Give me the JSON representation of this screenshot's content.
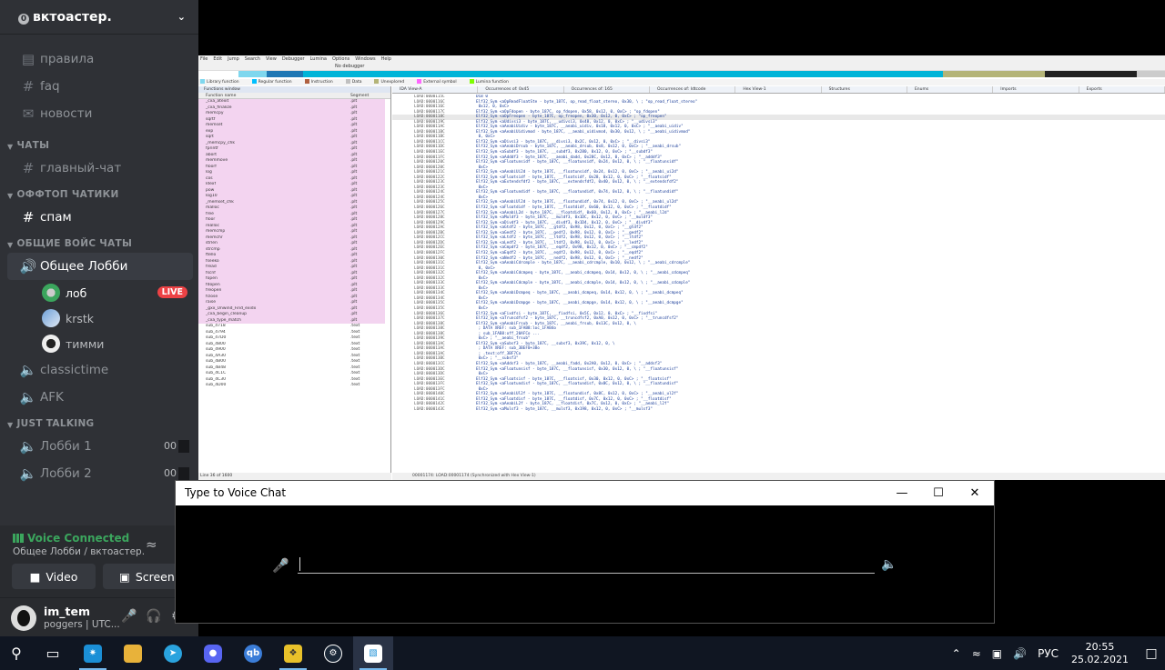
{
  "server": {
    "name": "вктоастер.",
    "badge": "0"
  },
  "channels_top": [
    {
      "icon": "📋",
      "label": "правила"
    },
    {
      "icon": "#",
      "label": "faq"
    },
    {
      "icon": "📢",
      "label": "новости"
    }
  ],
  "cat_chats": "ЧАТЫ",
  "chan_main": "главный-чат",
  "cat_offtop": "ОФФТОП ЧАТИКИ",
  "chan_spam": "спам",
  "cat_voice": "ОБЩИЕ ВОЙС ЧАТЫ",
  "chan_lobby": "Общее Лобби",
  "voice_users": [
    {
      "name": "лоб",
      "live": "LIVE"
    },
    {
      "name": "krstk"
    },
    {
      "name": "тимми"
    }
  ],
  "chan_classic": "classictime",
  "chan_afk": "AFK",
  "cat_just": "JUST TALKING",
  "lobby1": {
    "label": "Лобби 1",
    "count": "00"
  },
  "lobby2": {
    "label": "Лобби 2",
    "count": "00"
  },
  "voice_panel": {
    "status": "Voice Connected",
    "sub": "Общее Лобби / вктоастер.",
    "video_label": "Video",
    "screen_label": "Screen"
  },
  "user": {
    "name": "im_tem",
    "tag": "poggers | UTC..."
  },
  "ida": {
    "menu": [
      "File",
      "Edit",
      "Jump",
      "Search",
      "View",
      "Debugger",
      "Lumina",
      "Options",
      "Windows",
      "Help"
    ],
    "toolbar_debugger": "No debugger",
    "legend": [
      {
        "label": "Library function",
        "color": "#7fd7ee"
      },
      {
        "label": "Regular function",
        "color": "#00bfff"
      },
      {
        "label": "Instruction",
        "color": "#b06040"
      },
      {
        "label": "Data",
        "color": "#c0c0c0"
      },
      {
        "label": "Unexplored",
        "color": "#b4b478"
      },
      {
        "label": "External symbol",
        "color": "#ff66ff"
      },
      {
        "label": "Lumina function",
        "color": "#7fff00"
      }
    ],
    "func_window_title": "Functions window",
    "func_col_name": "Function name",
    "func_col_seg": "Segment",
    "functions": [
      [
        "_cxa_atexit",
        ".plt",
        1
      ],
      [
        "_cxa_finalize",
        ".plt",
        1
      ],
      [
        "memcpy",
        ".plt",
        1
      ],
      [
        "sqrtf",
        ".plt",
        1
      ],
      [
        "memset",
        ".plt",
        1
      ],
      [
        "exp",
        ".plt",
        1
      ],
      [
        "sqrt",
        ".plt",
        1
      ],
      [
        "_memcpy_chk",
        ".plt",
        1
      ],
      [
        "fprintf",
        ".plt",
        1
      ],
      [
        "abort",
        ".plt",
        1
      ],
      [
        "memmove",
        ".plt",
        1
      ],
      [
        "floorf",
        ".plt",
        1
      ],
      [
        "log",
        ".plt",
        1
      ],
      [
        "cos",
        ".plt",
        1
      ],
      [
        "ldexf",
        ".plt",
        1
      ],
      [
        "pow",
        ".plt",
        1
      ],
      [
        "log10",
        ".plt",
        1
      ],
      [
        "_memset_chk",
        ".plt",
        1
      ],
      [
        "malloc",
        ".plt",
        1
      ],
      [
        "free",
        ".plt",
        1
      ],
      [
        "floor",
        ".plt",
        1
      ],
      [
        "realloc",
        ".plt",
        1
      ],
      [
        "memcmp",
        ".plt",
        1
      ],
      [
        "memchr",
        ".plt",
        1
      ],
      [
        "strlen",
        ".plt",
        1
      ],
      [
        "strcmp",
        ".plt",
        1
      ],
      [
        "ftello",
        ".plt",
        1
      ],
      [
        "fseeko",
        ".plt",
        1
      ],
      [
        "fread",
        ".plt",
        1
      ],
      [
        "fscnf",
        ".plt",
        1
      ],
      [
        "fopen",
        ".plt",
        1
      ],
      [
        "fdopen",
        ".plt",
        1
      ],
      [
        "freopen",
        ".plt",
        1
      ],
      [
        "fclose",
        ".plt",
        1
      ],
      [
        "raise",
        ".plt",
        1
      ],
      [
        "_gxx_Unwind_Find_exidx",
        ".plt",
        1
      ],
      [
        "_cxa_begin_cleanup",
        ".plt",
        1
      ],
      [
        "_cxa_type_match",
        ".plt",
        1
      ],
      [
        "sub_4718",
        ".text",
        0
      ],
      [
        "sub_4794",
        ".text",
        0
      ],
      [
        "sub_47D0",
        ".text",
        0
      ],
      [
        "sub_4800",
        ".text",
        0
      ],
      [
        "sub_4900",
        ".text",
        0
      ],
      [
        "sub_4A30",
        ".text",
        0
      ],
      [
        "sub_4B00",
        ".text",
        0
      ],
      [
        "sub_4B48",
        ".text",
        0
      ],
      [
        "sub_4C1C",
        ".text",
        0
      ],
      [
        "sub_4C30",
        ".text",
        0
      ],
      [
        "sub_4D00",
        ".text",
        0
      ]
    ],
    "func_footer": "Line 36 of 1600",
    "tabs": [
      "IDA View-A",
      "Occurrences of: 0x45",
      "Occurrences of: 165",
      "Occurrences of: Idtcode",
      "Hex View-1",
      "Structures",
      "Enums",
      "Imports",
      "Exports"
    ],
    "code": [
      [
        "LOAD:0000115C",
        "DCB 0"
      ],
      [
        "LOAD:0000116C",
        "Elf32_Sym <aOpReadFloatSte - byte_187C, op_read_float_stereo, 0x30, \\ ; \"op_read_float_stereo\""
      ],
      [
        "LOAD:0000116C",
        "                   0x12, 0, 0xC>"
      ],
      [
        "LOAD:0000117C",
        "Elf32_Sym <aOpFdopen - byte_187C, op_fdopen, 0x58, 0x12, 0, 0xC> ; \"op_fdopen\""
      ],
      [
        "LOAD:0000118C",
        "Elf32_Sym <aOpFreopen - byte_187C, op_freopen, 0x30, 0x12, 0, 0xC> ; \"op_freopen\""
      ],
      [
        "LOAD:0000119C",
        "Elf32_Sym <aUdivsi3 - byte_187C, __udivsi3, 0x48, 0x12, 0, 0xC> ; \"__udivsi3\""
      ],
      [
        "LOAD:000011AC",
        "Elf32_Sym <aAeabiUidiv - byte_187C, __aeabi_uidiv, 0x18, 0x12, 0, 0xC> ; \"__aeabi_uidiv\""
      ],
      [
        "LOAD:000011BC",
        "Elf32_Sym <aAeabiUidivmod - byte_187C, __aeabi_uidivmod, 0x30, 0x12, \\ ; \"__aeabi_uidivmod\""
      ],
      [
        "LOAD:000011BC",
        "                   0, 0xC>"
      ],
      [
        "LOAD:000011CC",
        "Elf32_Sym <aDivsi3 - byte_187C, __divsi3, 0x2C, 0x12, 0, 0xC> ; \"__divsi3\""
      ],
      [
        "LOAD:000011DC",
        "Elf32_Sym <aAeabiDrsub - byte_187C, __aeabi_drsub, 0x8, 0x12, 0, 0xC> ; \"__aeabi_drsub\""
      ],
      [
        "LOAD:000011EC",
        "Elf32_Sym <aSubdf3 - byte_187C, __subdf3, 0x280, 0x12, 0, 0xC> ; \"__subdf3\""
      ],
      [
        "LOAD:000011FC",
        "Elf32_Sym <aAdddf3 - byte_187C, __aeabi_dadd, 0x28C, 0x12, 0, 0xC> ; \"__adddf3\""
      ],
      [
        "LOAD:0000120C",
        "Elf32_Sym <aFloatunsidf - byte_187C, __floatunsidf, 0x24, 0x12, 0, \\ ; \"__floatunsidf\""
      ],
      [
        "LOAD:0000120C",
        "                   0xC>"
      ],
      [
        "LOAD:0000121C",
        "Elf32_Sym <aAeabiUi2d - byte_187C, __floatunsidf, 0x24, 0x12, 0, 0xC> ; \"__aeabi_ui2d\""
      ],
      [
        "LOAD:0000122C",
        "Elf32_Sym <aFloatsidf - byte_187C, __floatsidf, 0x28, 0x12, 0, 0xC> ; \"__floatsidf\""
      ],
      [
        "LOAD:0000123C",
        "Elf32_Sym <aExtendsfdf2 - byte_187C, __extendsfdf2, 0x40, 0x12, 0, \\ ; \"__extendsfdf2\""
      ],
      [
        "LOAD:0000123C",
        "                   0xC>"
      ],
      [
        "LOAD:0000124C",
        "Elf32_Sym <aFloatundidf - byte_187C, __floatundidf, 0x74, 0x12, 0, \\ ; \"__floatundidf\""
      ],
      [
        "LOAD:0000124C",
        "                   0xC>"
      ],
      [
        "LOAD:0000125C",
        "Elf32_Sym <aAeabiUl2d - byte_187C, __floatundidf, 0x74, 0x12, 0, 0xC> ; \"__aeabi_ul2d\""
      ],
      [
        "LOAD:0000126C",
        "Elf32_Sym <aFloatdidf - byte_187C, __floatdidf, 0x60, 0x12, 0, 0xC> ; \"__floatdidf\""
      ],
      [
        "LOAD:0000127C",
        "Elf32_Sym <aAeabiL2d - byte_187C, __floatdidf, 0x60, 0x12, 0, 0xC> ; \"__aeabi_l2d\""
      ],
      [
        "LOAD:0000128C",
        "Elf32_Sym <aMuldf3 - byte_187C, __muldf3, 0x1DC, 0x12, 0, 0xC> ; \"__muldf3\""
      ],
      [
        "LOAD:0000129C",
        "Elf32_Sym <aDivdf3 - byte_187C, __divdf3, 0x1D4, 0x12, 0, 0xC> ; \"__divdf3\""
      ],
      [
        "LOAD:000012AC",
        "Elf32_Sym <aGtdf2 - byte_187C, __gtdf2, 0x98, 0x12, 0, 0xC> ; \"__gtdf2\""
      ],
      [
        "LOAD:000012BC",
        "Elf32_Sym <aGedf2 - byte_187C, __gedf2, 0x98, 0x12, 0, 0xC> ; \"__gedf2\""
      ],
      [
        "LOAD:000012CC",
        "Elf32_Sym <aLtdf2 - byte_187C, __ltdf2, 0x98, 0x12, 0, 0xC> ; \"__ltdf2\""
      ],
      [
        "LOAD:000012DC",
        "Elf32_Sym <aLedf2 - byte_187C, __ltdf2, 0x98, 0x12, 0, 0xC> ; \"__ledf2\""
      ],
      [
        "LOAD:000012EC",
        "Elf32_Sym <aCmpdf2 - byte_187C, __eqdf2, 0x98, 0x12, 0, 0xC> ; \"__cmpdf2\""
      ],
      [
        "LOAD:000012FC",
        "Elf32_Sym <aEqdf2 - byte_187C, __eqdf2, 0x98, 0x12, 0, 0xC> ; \"__eqdf2\""
      ],
      [
        "LOAD:0000130C",
        "Elf32_Sym <aNedf2 - byte_187C, __nedf2, 0x98, 0x12, 0, 0xC> ; \"__nedf2\""
      ],
      [
        "LOAD:0000131C",
        "Elf32_Sym <aAeabiCdrcmple - byte_187C, __aeabi_cdrcmple, 0x10, 0x12, \\ ; \"__aeabi_cdrcmple\""
      ],
      [
        "LOAD:0000131C",
        "                   0, 0xC>"
      ],
      [
        "LOAD:0000132C",
        "Elf32_Sym <aAeabiCdcmpeq - byte_187C, __aeabi_cdcmpeq, 0x14, 0x12, 0, \\ ; \"__aeabi_cdcmpeq\""
      ],
      [
        "LOAD:0000132C",
        "                   0xC>"
      ],
      [
        "LOAD:0000133C",
        "Elf32_Sym <aAeabiCdcmple - byte_187C, __aeabi_cdcmple, 0x14, 0x12, 0, \\ ; \"__aeabi_cdcmple\""
      ],
      [
        "LOAD:0000133C",
        "                   0xC>"
      ],
      [
        "LOAD:0000134C",
        "Elf32_Sym <aAeabiDcmpeq - byte_187C, __aeabi_dcmpeq, 0x14, 0x12, 0, \\ ; \"__aeabi_dcmpeq\""
      ],
      [
        "LOAD:0000134C",
        "                   0xC>"
      ],
      [
        "LOAD:0000135C",
        "Elf32_Sym <aAeabiDcmpge - byte_187C, __aeabi_dcmpge, 0x14, 0x12, 0, \\ ; \"__aeabi_dcmpge\""
      ],
      [
        "LOAD:0000135C",
        "                   0xC>"
      ],
      [
        "LOAD:0000136C",
        "Elf32_Sym <aFixdfsi - byte_187C, __fixdfsi, 0x5C, 0x12, 0, 0xC> ; \"__fixdfsi\""
      ],
      [
        "LOAD:0000137C",
        "Elf32_Sym <aTruncdfsf2 - byte_187C, __truncdfsf2, 0xA0, 0x12, 0, 0xC> ; \"__truncdfsf2\""
      ],
      [
        "LOAD:0000138C",
        "Elf32_Sym <aAeabiFrsub - byte_187C, __aeabi_frsub, 0x13C, 0x12, 0, \\"
      ],
      [
        "LOAD:0000138C",
        "                   ; DATA XREF: sub_1FAB8:loc_1FAB4o"
      ],
      [
        "LOAD:0000138C",
        "                   ; sub_1FAB8:off_20AFCo ..."
      ],
      [
        "LOAD:0000139C",
        "                   0xC>   ; \"__aeabi_frsub\""
      ],
      [
        "LOAD:000013AC",
        "Elf32_Sym <aSubsf3 - byte_187C, __subsf3, 0x39C, 0x12, 0, \\"
      ],
      [
        "LOAD:000013AC",
        "                   ; DATA XREF: sub_3BEF0+38o"
      ],
      [
        "LOAD:000013AC",
        "                   ; .text:off_3BF7Co"
      ],
      [
        "LOAD:000013BC",
        "                   0xC>   ; \"__subsf3\""
      ],
      [
        "LOAD:000013CC",
        "Elf32_Sym <aAddsf3 - byte_187C, __aeabi_fadd, 0x2A0, 0x12, 0, 0xC> ; \"__addsf3\""
      ],
      [
        "LOAD:000013DC",
        "Elf32_Sym <aFloatunsisf - byte_187C, __floatunsisf, 0x30, 0x12, 0, \\ ; \"__floatunsisf\""
      ],
      [
        "LOAD:000013DC",
        "                   0xC>"
      ],
      [
        "LOAD:000013EC",
        "Elf32_Sym <aFloatsisf - byte_187C, __floatsisf, 0x30, 0x12, 0, 0xC> ; \"__floatsisf\""
      ],
      [
        "LOAD:000013FC",
        "Elf32_Sym <aFloatundisf - byte_187C, __floatundisf, 0x8C, 0x12, 0, \\ ; \"__floatundisf\""
      ],
      [
        "LOAD:000013FC",
        "                   0xC>"
      ],
      [
        "LOAD:0000140C",
        "Elf32_Sym <aAeabiUl2f - byte_187C, __floatundisf, 0x8C, 0x12, 0, 0xC> ; \"__aeabi_ul2f\""
      ],
      [
        "LOAD:0000141C",
        "Elf32_Sym <aFloatdisf - byte_187C, __floatdisf, 0x7C, 0x12, 0, 0xC> ; \"__floatdisf\""
      ],
      [
        "LOAD:0000142C",
        "Elf32_Sym <aAeabiL2f - byte_187C, __floatdisf, 0x7C, 0x12, 0, 0xC> ; \"__aeabi_l2f\""
      ],
      [
        "LOAD:0000143C",
        "Elf32_Sym <aMulsf3 - byte_187C, __mulsf3, 0x198, 0x12, 0, 0xC> ; \"__mulsf3\""
      ]
    ],
    "status_line": "00001174: LOAD:00001174 (Synchronized with Hex View-1)"
  },
  "dialog": {
    "title": "Type to Voice Chat",
    "input_value": ""
  },
  "taskbar": {
    "lang": "РУС",
    "time": "20:55",
    "date": "25.02.2021"
  }
}
